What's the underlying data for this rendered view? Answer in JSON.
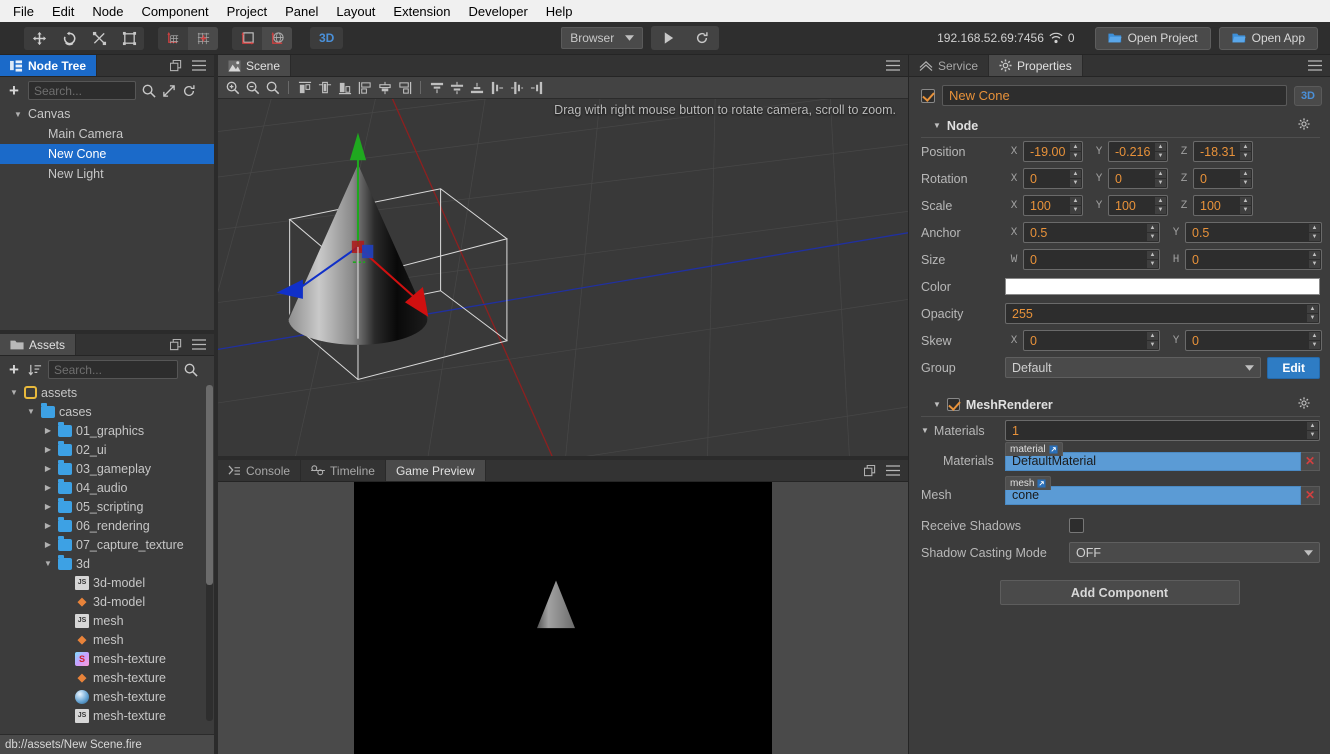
{
  "menubar": {
    "items": [
      "File",
      "Edit",
      "Node",
      "Component",
      "Project",
      "Panel",
      "Layout",
      "Extension",
      "Developer",
      "Help"
    ]
  },
  "toolbar": {
    "transform_tools": [
      {
        "name": "move-tool",
        "icon": "move-icon",
        "active": false
      },
      {
        "name": "rotate-tool",
        "icon": "rotate-icon",
        "active": false
      },
      {
        "name": "scale-tool",
        "icon": "scale-icon",
        "active": false
      },
      {
        "name": "rect-tool",
        "icon": "rect-transform-icon",
        "active": false
      }
    ],
    "pivot_tools": [
      {
        "name": "pivot-tool",
        "icon": "pivot-icon",
        "active": false
      },
      {
        "name": "center-tool",
        "icon": "center-icon",
        "active": true
      }
    ],
    "coord_tools": [
      {
        "name": "local-coord-tool",
        "icon": "local-axis-icon",
        "active": false
      },
      {
        "name": "global-coord-tool",
        "icon": "global-axis-icon",
        "active": true
      }
    ],
    "mode_3d_label": "3D",
    "browser_label": "Browser",
    "play_label": "play-icon",
    "refresh_label": "refresh-icon",
    "ip_address": "192.168.52.69:7456",
    "device_count": "0",
    "open_project_label": "Open Project",
    "open_app_label": "Open App"
  },
  "node_tree": {
    "tab_label": "Node Tree",
    "search_placeholder": "Search...",
    "search_value": "",
    "nodes": [
      {
        "label": "Canvas",
        "depth": 0,
        "expandable": true,
        "expanded": true,
        "selected": false
      },
      {
        "label": "Main Camera",
        "depth": 1,
        "expandable": false,
        "expanded": false,
        "selected": false
      },
      {
        "label": "New Cone",
        "depth": 1,
        "expandable": false,
        "expanded": false,
        "selected": true
      },
      {
        "label": "New Light",
        "depth": 1,
        "expandable": false,
        "expanded": false,
        "selected": false
      }
    ]
  },
  "assets": {
    "tab_label": "Assets",
    "search_placeholder": "Search...",
    "search_value": "",
    "status_path": "db://assets/New Scene.fire",
    "nodes": [
      {
        "label": "assets",
        "depth": 0,
        "icon": "assets-root-icon",
        "expandable": true,
        "expanded": true
      },
      {
        "label": "cases",
        "depth": 1,
        "icon": "folder-icon",
        "expandable": true,
        "expanded": true
      },
      {
        "label": "01_graphics",
        "depth": 2,
        "icon": "folder-icon",
        "expandable": true,
        "expanded": false
      },
      {
        "label": "02_ui",
        "depth": 2,
        "icon": "folder-icon",
        "expandable": true,
        "expanded": false
      },
      {
        "label": "03_gameplay",
        "depth": 2,
        "icon": "folder-icon",
        "expandable": true,
        "expanded": false
      },
      {
        "label": "04_audio",
        "depth": 2,
        "icon": "folder-icon",
        "expandable": true,
        "expanded": false
      },
      {
        "label": "05_scripting",
        "depth": 2,
        "icon": "folder-icon",
        "expandable": true,
        "expanded": false
      },
      {
        "label": "06_rendering",
        "depth": 2,
        "icon": "folder-icon",
        "expandable": true,
        "expanded": false
      },
      {
        "label": "07_capture_texture",
        "depth": 2,
        "icon": "folder-icon",
        "expandable": true,
        "expanded": false
      },
      {
        "label": "3d",
        "depth": 2,
        "icon": "folder-icon",
        "expandable": true,
        "expanded": true
      },
      {
        "label": "3d-model",
        "depth": 3,
        "icon": "js-icon",
        "expandable": false,
        "expanded": false
      },
      {
        "label": "3d-model",
        "depth": 3,
        "icon": "fire-scene-icon",
        "expandable": false,
        "expanded": false
      },
      {
        "label": "mesh",
        "depth": 3,
        "icon": "js-icon",
        "expandable": false,
        "expanded": false
      },
      {
        "label": "mesh",
        "depth": 3,
        "icon": "fire-scene-icon",
        "expandable": false,
        "expanded": false
      },
      {
        "label": "mesh-texture",
        "depth": 3,
        "icon": "sprite-icon",
        "expandable": false,
        "expanded": false
      },
      {
        "label": "mesh-texture",
        "depth": 3,
        "icon": "fire-scene-icon",
        "expandable": false,
        "expanded": false
      },
      {
        "label": "mesh-texture",
        "depth": 3,
        "icon": "sphere-icon",
        "expandable": false,
        "expanded": false
      },
      {
        "label": "mesh-texture",
        "depth": 3,
        "icon": "js-icon",
        "expandable": false,
        "expanded": false
      }
    ]
  },
  "scene": {
    "tab_label": "Scene",
    "hint": "Drag with right mouse button to rotate camera, scroll to zoom.",
    "tools": [
      {
        "name": "zoom-in-icon"
      },
      {
        "name": "zoom-out-icon"
      },
      {
        "name": "zoom-fit-icon"
      },
      {
        "name": "align-left-icon"
      },
      {
        "name": "align-center-h-icon"
      },
      {
        "name": "align-right-icon"
      },
      {
        "name": "align-top-icon"
      },
      {
        "name": "align-middle-v-icon"
      },
      {
        "name": "align-bottom-icon"
      },
      {
        "name": "distribute-top-icon"
      },
      {
        "name": "distribute-center-icon"
      },
      {
        "name": "distribute-bottom-icon"
      },
      {
        "name": "distribute-left-icon"
      },
      {
        "name": "distribute-middle-icon"
      },
      {
        "name": "distribute-right-icon"
      }
    ]
  },
  "bottom_tabs": [
    {
      "label": "Console",
      "icon": "console-icon",
      "active": false
    },
    {
      "label": "Timeline",
      "icon": "timeline-icon",
      "active": false
    },
    {
      "label": "Game Preview",
      "icon": "",
      "active": true
    }
  ],
  "properties": {
    "tabs": [
      {
        "label": "Service",
        "icon": "service-icon",
        "active": false
      },
      {
        "label": "Properties",
        "icon": "gear-icon",
        "active": true
      }
    ],
    "node_enabled": true,
    "node_name": "New Cone",
    "node_badge": "3D",
    "node_section_label": "Node",
    "fields": {
      "position": {
        "label": "Position",
        "axes": [
          "X",
          "Y",
          "Z"
        ],
        "values": [
          "-19.00",
          "-0.216",
          "-18.31"
        ]
      },
      "rotation": {
        "label": "Rotation",
        "axes": [
          "X",
          "Y",
          "Z"
        ],
        "values": [
          "0",
          "0",
          "0"
        ]
      },
      "scale": {
        "label": "Scale",
        "axes": [
          "X",
          "Y",
          "Z"
        ],
        "values": [
          "100",
          "100",
          "100"
        ]
      },
      "anchor": {
        "label": "Anchor",
        "axes": [
          "X",
          "Y"
        ],
        "values": [
          "0.5",
          "0.5"
        ]
      },
      "size": {
        "label": "Size",
        "axes": [
          "W",
          "H"
        ],
        "values": [
          "0",
          "0"
        ]
      },
      "color": {
        "label": "Color",
        "value": "#ffffff"
      },
      "opacity": {
        "label": "Opacity",
        "value": "255"
      },
      "skew": {
        "label": "Skew",
        "axes": [
          "X",
          "Y"
        ],
        "values": [
          "0",
          "0"
        ]
      },
      "group": {
        "label": "Group",
        "value": "Default",
        "edit_label": "Edit"
      }
    },
    "mesh_renderer": {
      "label": "MeshRenderer",
      "enabled": true,
      "materials_label": "Materials",
      "materials_count": "1",
      "materials_item_label": "Materials",
      "material_tag": "material",
      "material_value": "DefaultMaterial",
      "mesh_label": "Mesh",
      "mesh_tag": "mesh",
      "mesh_value": "cone",
      "receive_shadows_label": "Receive Shadows",
      "receive_shadows": false,
      "shadow_casting_label": "Shadow Casting Mode",
      "shadow_casting_value": "OFF"
    },
    "add_component_label": "Add Component"
  },
  "colors": {
    "accent_blue": "#1b6ac9",
    "value_orange": "#e8923a",
    "asset_blue": "#5b9bd5",
    "panel_bg": "#3c3c3c",
    "viewport_bg": "#393939"
  }
}
